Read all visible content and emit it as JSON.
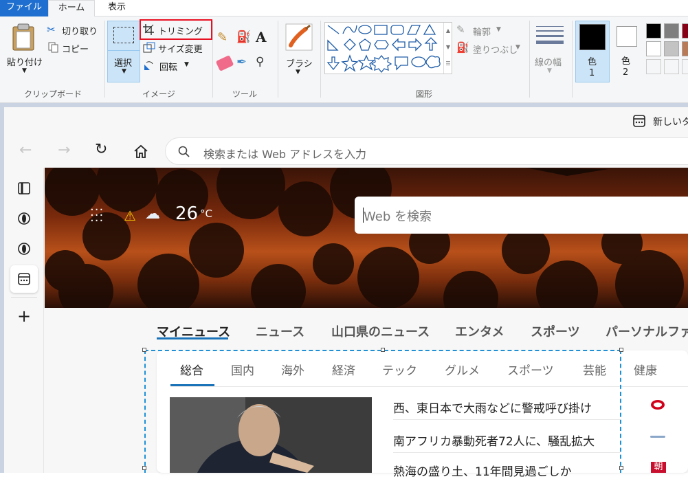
{
  "ribbon": {
    "tabs": {
      "file": "ファイル",
      "home": "ホーム",
      "view": "表示"
    },
    "clipboard": {
      "paste": "貼り付け",
      "cut": "切り取り",
      "copy": "コピー",
      "group_label": "クリップボード"
    },
    "image": {
      "select": "選択",
      "crop": "トリミング",
      "resize": "サイズ変更",
      "rotate": "回転",
      "group_label": "イメージ"
    },
    "tools": {
      "group_label": "ツール"
    },
    "brushes": {
      "label": "ブラシ"
    },
    "shapes": {
      "outline": "輪郭",
      "fill": "塗りつぶし",
      "group_label": "図形"
    },
    "line_width": {
      "label": "線の幅"
    },
    "colors": {
      "color1": "色",
      "color1_num": "1",
      "color2": "色",
      "color2_num": "2",
      "palette": [
        "#000000",
        "#7f7f7f",
        "#880015",
        "#ffffff",
        "#c3c3c3",
        "#b97a57"
      ]
    },
    "highlight_color": "#e81123"
  },
  "browser": {
    "new_tab": "新しいタブ",
    "address_placeholder": "検索または Web アドレスを入力",
    "weather": {
      "temp": "26",
      "unit": "°C"
    },
    "search_placeholder": "Web を検索",
    "main_tabs": [
      "マイニュース",
      "ニュース",
      "山口県のニュース",
      "エンタメ",
      "スポーツ",
      "パーソナルファ"
    ],
    "sub_tabs": [
      "総合",
      "国内",
      "海外",
      "経済",
      "テック",
      "グルメ",
      "スポーツ",
      "芸能",
      "健康"
    ],
    "headlines": [
      "西、東日本で大雨などに警戒呼び掛け",
      "南アフリカ暴動死者72人に、騒乱拡大",
      "熱海の盛り土、11年間見過ごしか"
    ],
    "source_badge_3": "朝",
    "accent": "#1a73b8",
    "selection_color": "#1e90d6"
  }
}
